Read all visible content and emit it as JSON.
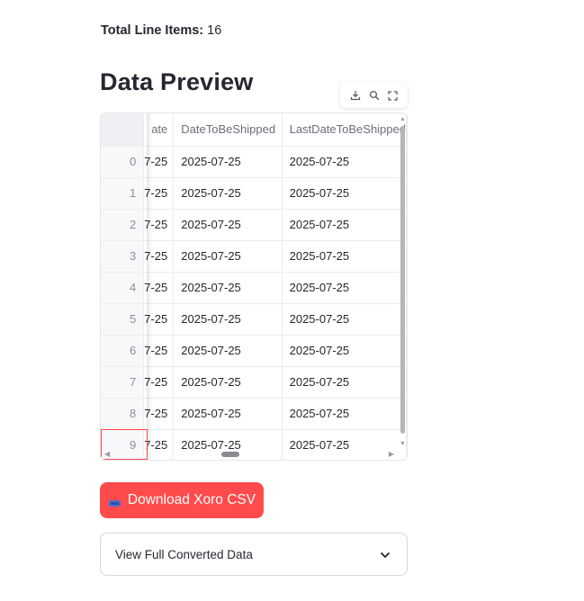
{
  "summary": {
    "label": "Total Line Items:",
    "value": "16"
  },
  "section": {
    "title": "Data Preview"
  },
  "toolbar": {
    "icons": [
      "download-icon",
      "search-icon",
      "fullscreen-icon"
    ]
  },
  "table": {
    "columns": [
      "ate",
      "DateToBeShipped",
      "LastDateToBeShipped"
    ],
    "rows": [
      {
        "index": "0",
        "a": "7-25",
        "b": "2025-07-25",
        "c": "2025-07-25"
      },
      {
        "index": "1",
        "a": "7-25",
        "b": "2025-07-25",
        "c": "2025-07-25"
      },
      {
        "index": "2",
        "a": "7-25",
        "b": "2025-07-25",
        "c": "2025-07-25"
      },
      {
        "index": "3",
        "a": "7-25",
        "b": "2025-07-25",
        "c": "2025-07-25"
      },
      {
        "index": "4",
        "a": "7-25",
        "b": "2025-07-25",
        "c": "2025-07-25"
      },
      {
        "index": "5",
        "a": "7-25",
        "b": "2025-07-25",
        "c": "2025-07-25"
      },
      {
        "index": "6",
        "a": "7-25",
        "b": "2025-07-25",
        "c": "2025-07-25"
      },
      {
        "index": "7",
        "a": "7-25",
        "b": "2025-07-25",
        "c": "2025-07-25"
      },
      {
        "index": "8",
        "a": "7-25",
        "b": "2025-07-25",
        "c": "2025-07-25"
      },
      {
        "index": "9",
        "a": "7-25",
        "b": "2025-07-25",
        "c": "2025-07-25"
      }
    ]
  },
  "download": {
    "label": "Download Xoro CSV",
    "icon": "inbox-tray-icon"
  },
  "expander": {
    "label": "View Full Converted Data",
    "icon": "chevron-down-icon"
  },
  "colors": {
    "accent": "#ff4b4b",
    "text": "#262730",
    "border": "#e6e6ea"
  }
}
